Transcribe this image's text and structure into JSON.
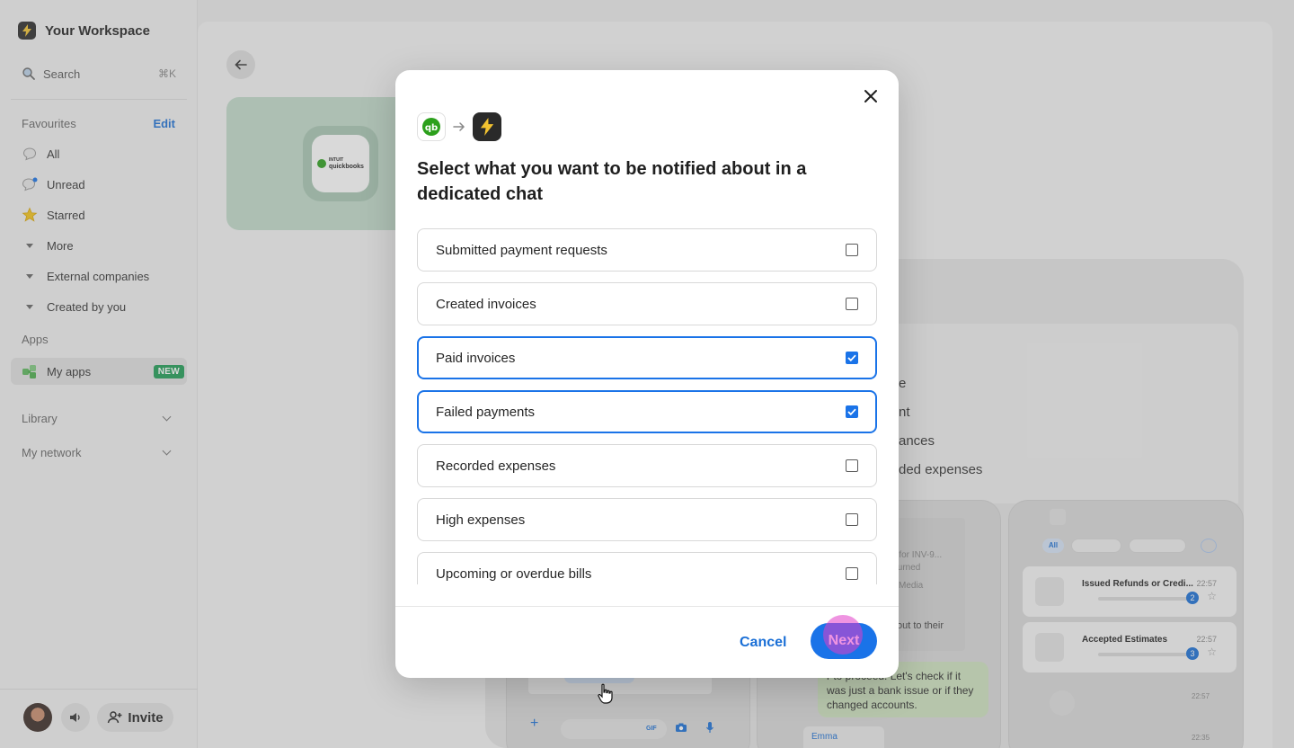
{
  "sidebar": {
    "workspace_name": "Your Workspace",
    "search_label": "Search",
    "search_shortcut": "⌘K",
    "favourites_title": "Favourites",
    "edit_label": "Edit",
    "items": [
      {
        "label": "All"
      },
      {
        "label": "Unread"
      },
      {
        "label": "Starred"
      },
      {
        "label": "More"
      },
      {
        "label": "External companies"
      },
      {
        "label": "Created by you"
      }
    ],
    "apps_title": "Apps",
    "my_apps_label": "My apps",
    "new_badge": "NEW",
    "library_label": "Library",
    "network_label": "My network",
    "invite_label": "Invite"
  },
  "background": {
    "hero_logo_text_1": "INTUIT",
    "hero_logo_text_2": "quickbooks",
    "list_fragments": [
      "e",
      "nt",
      "ances",
      "ded expenses"
    ],
    "card_1_title": "Issued Refunds or Credi...",
    "card_1_time": "22:57",
    "card_1_count": "2",
    "card_2_title": "Accepted Estimates",
    "card_2_time": "22:57",
    "card_2_count": "3",
    "card_3_time": "22:57",
    "card_4_time": "22:35",
    "chip_all": "All",
    "chat_fragment_1": "d for INV-9...",
    "chat_fragment_2": "turned",
    "chat_fragment_3": "Media",
    "chat_fragment_4": "out to their",
    "green_bubble_text": "r to proceed. Let's check if it was just a bank issue or if they changed accounts.",
    "emma_label": "Emma",
    "gif_label": "GIF"
  },
  "modal": {
    "title": "Select what you want to be notified about in a dedicated chat",
    "options": [
      {
        "label": "Submitted payment requests",
        "checked": false
      },
      {
        "label": "Created invoices",
        "checked": false
      },
      {
        "label": "Paid invoices",
        "checked": true
      },
      {
        "label": "Failed payments",
        "checked": true
      },
      {
        "label": "Recorded expenses",
        "checked": false
      },
      {
        "label": "High expenses",
        "checked": false
      },
      {
        "label": "Upcoming or overdue bills",
        "checked": false
      }
    ],
    "cancel_label": "Cancel",
    "next_label": "Next"
  },
  "colors": {
    "accent": "#1a73e8",
    "link": "#1a6fd6",
    "new_badge": "#1f9d55",
    "quickbooks_green": "#2ca01c"
  }
}
